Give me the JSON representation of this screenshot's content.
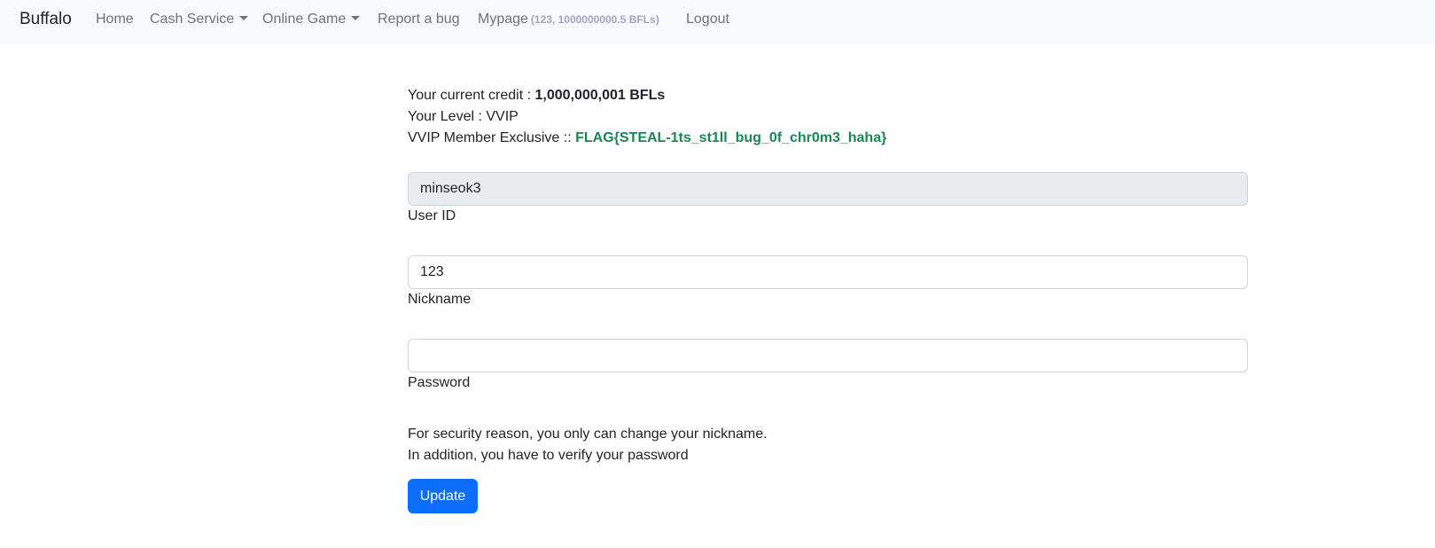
{
  "nav": {
    "brand": "Buffalo",
    "home": "Home",
    "cash_service": "Cash Service",
    "online_game": "Online Game",
    "report_bug": "Report a bug",
    "mypage": "Mypage",
    "mypage_extra": "(123, 1000000000.5 BFLs)",
    "logout": "Logout"
  },
  "info": {
    "credit_label": "Your current credit : ",
    "credit_value": "1,000,000,001 BFLs",
    "level_label": "Your Level : ",
    "level_value": "VVIP",
    "exclusive_label": "VVIP Member Exclusive :: ",
    "flag": "FLAG{STEAL-1ts_st1ll_bug_0f_chr0m3_haha}"
  },
  "form": {
    "user_id_value": "minseok3",
    "user_id_label": "User ID",
    "nickname_value": "123",
    "nickname_label": "Nickname",
    "password_value": "",
    "password_label": "Password",
    "note_line1": "For security reason, you only can change your nickname.",
    "note_line2": "In addition, you have to verify your password",
    "update_label": "Update"
  },
  "colors": {
    "navbar_bg": "#f8f9fa",
    "flag_green": "#198754",
    "button_blue": "#0d6efd",
    "mypage_extra": "#a4a4c8"
  }
}
